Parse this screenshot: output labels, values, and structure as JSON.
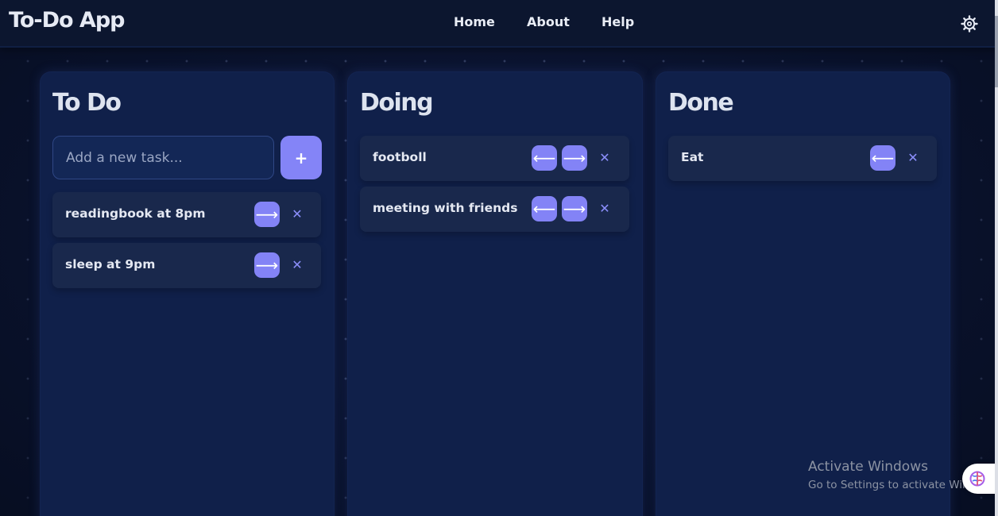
{
  "app": {
    "title": "To-Do App"
  },
  "nav": {
    "items": [
      {
        "label": "Home"
      },
      {
        "label": "About"
      },
      {
        "label": "Help"
      }
    ],
    "settings_icon": "gear-icon"
  },
  "columns": [
    {
      "title": "To Do",
      "input": {
        "placeholder": "Add a new task...",
        "value": ""
      },
      "add_button_label": "+",
      "tasks": [
        {
          "text": "readingbook at 8pm"
        },
        {
          "text": "sleep at 9pm"
        }
      ]
    },
    {
      "title": "Doing",
      "tasks": [
        {
          "text": "footboll"
        },
        {
          "text": "meeting with friends"
        }
      ]
    },
    {
      "title": "Done",
      "tasks": [
        {
          "text": "Eat"
        }
      ]
    }
  ],
  "controls": {
    "move_left": "⟵",
    "move_right": "⟶",
    "delete": "✕"
  },
  "watermark": {
    "title": "Activate Windows",
    "subtitle": "Go to Settings to activate Windows."
  },
  "colors": {
    "background": "#0b1430",
    "column": "#10204a",
    "card": "#19284c",
    "accent": "#8484f7",
    "text": "#e4e8f2"
  }
}
